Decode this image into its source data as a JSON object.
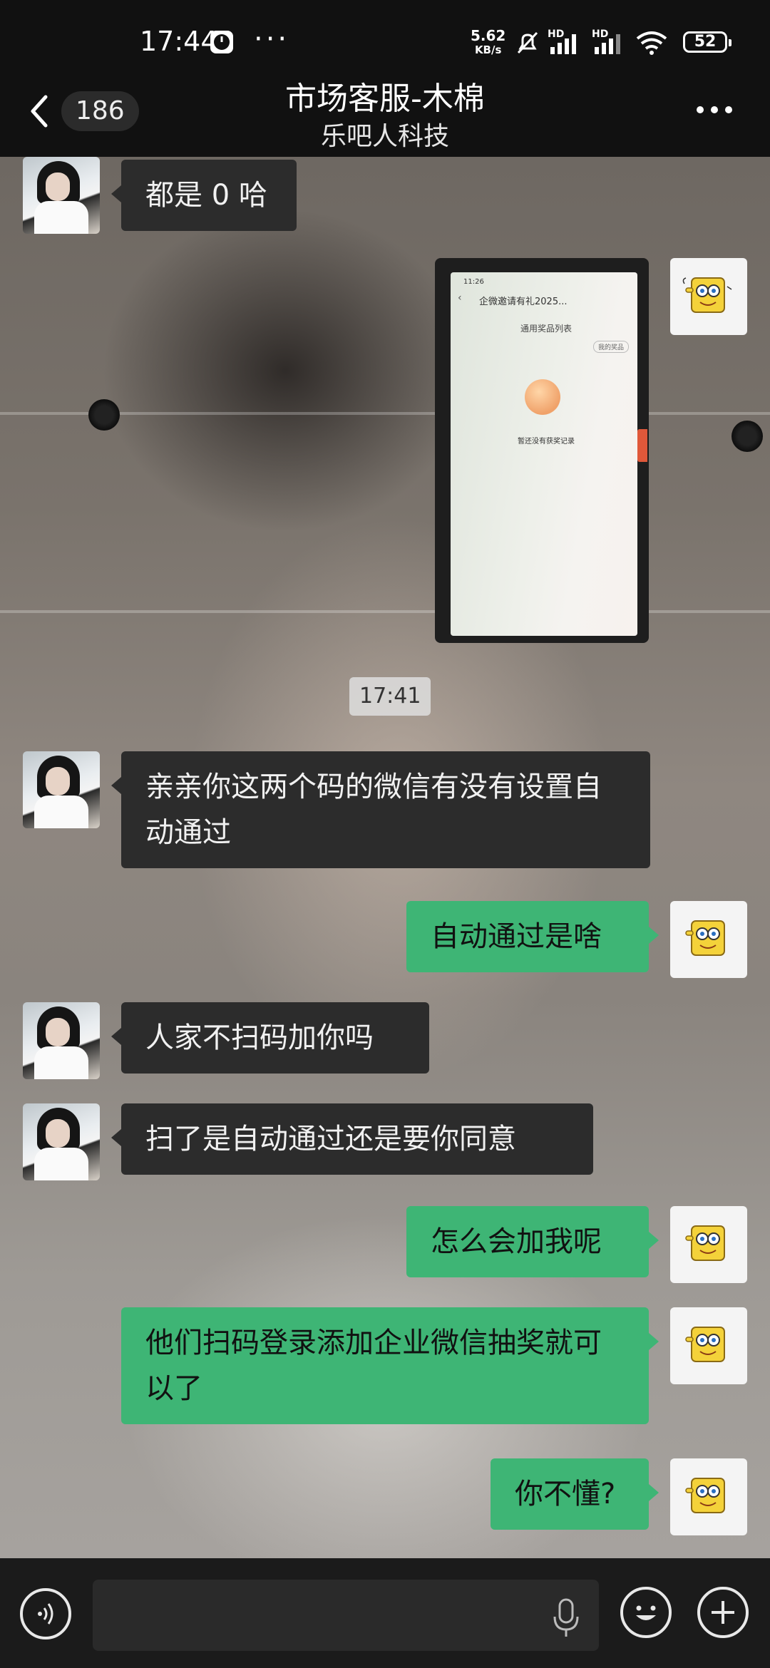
{
  "status_bar": {
    "time": "17:44",
    "net_speed": "5.62",
    "net_unit": "KB/s",
    "signal1_label": "HD",
    "signal2_label": "HD",
    "battery": "52",
    "icons": [
      "clock-icon",
      "more-dots-icon",
      "mute-bell-icon",
      "signal-icon",
      "wifi-icon",
      "battery-icon"
    ]
  },
  "header": {
    "unread_count": "186",
    "title": "市场客服-木棉",
    "subtitle": "乐吧人科技",
    "back_icon": "chevron-left-icon",
    "more_icon": "more-horizontal-icon"
  },
  "messages": [
    {
      "side": "left",
      "type": "text",
      "text": "都是 0 哈"
    },
    {
      "side": "right",
      "type": "image",
      "image": {
        "status": "11:26",
        "title": "企微邀请有礼2025...",
        "list_title": "通用奖品列表",
        "mine_label": "我的奖品",
        "empty_text": "暂还没有获奖记录"
      }
    },
    {
      "type": "time",
      "text": "17:41"
    },
    {
      "side": "left",
      "type": "text",
      "text": "亲亲你这两个码的微信有没有设置自动通过"
    },
    {
      "side": "right",
      "type": "text",
      "text": "自动通过是啥"
    },
    {
      "side": "left",
      "type": "text",
      "text": "人家不扫码加你吗"
    },
    {
      "side": "left",
      "type": "text",
      "text": "扫了是自动通过还是要你同意"
    },
    {
      "side": "right",
      "type": "text",
      "text": "怎么会加我呢"
    },
    {
      "side": "right",
      "type": "text",
      "text": "他们扫码登录添加企业微信抽奖就可以了"
    },
    {
      "side": "right",
      "type": "text",
      "text": "你不懂?"
    }
  ],
  "input_bar": {
    "voice_icon": "voice-icon",
    "mic_icon": "microphone-icon",
    "emoji_icon": "emoji-icon",
    "add_icon": "plus-icon",
    "placeholder": ""
  },
  "colors": {
    "bubble_mine": "#3eb575",
    "bubble_other": "#2c2c2c",
    "bar_background": "#111111"
  }
}
